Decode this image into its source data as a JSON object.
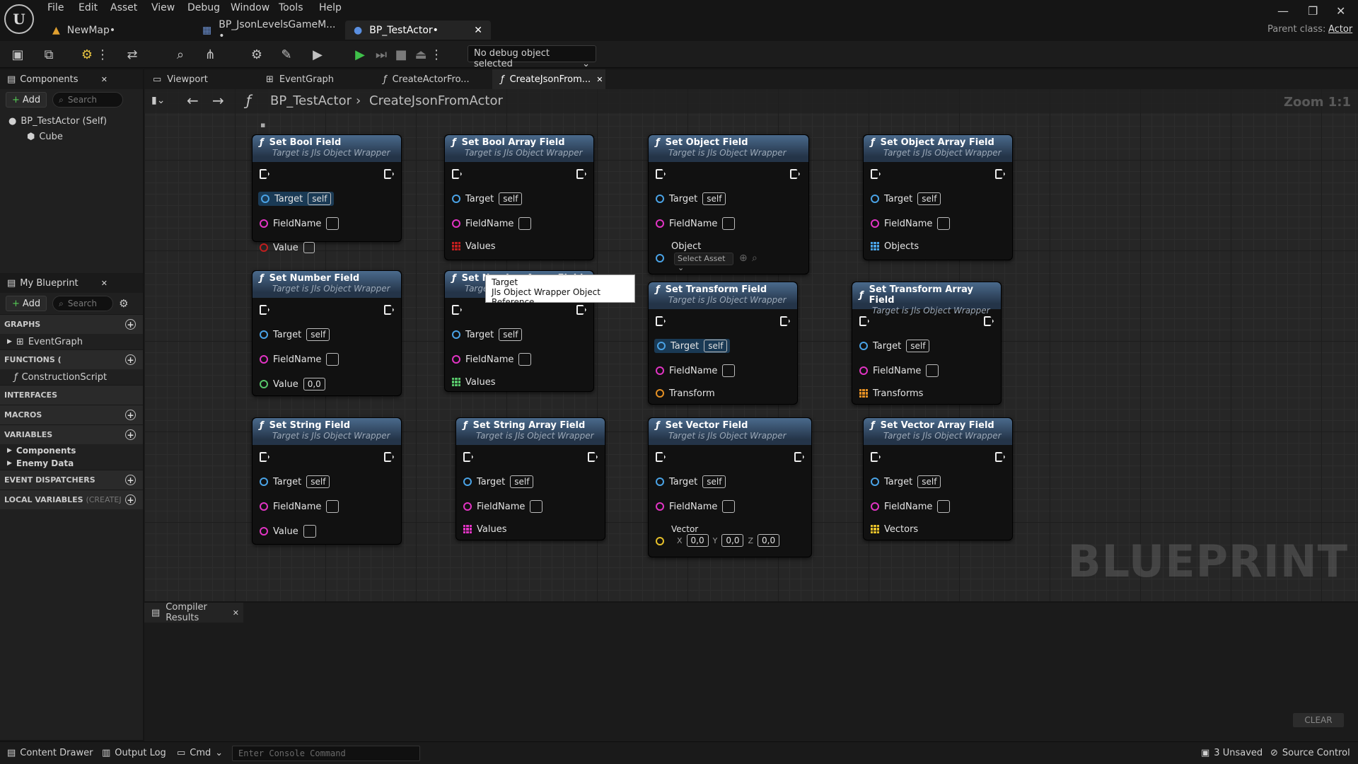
{
  "menu": [
    "File",
    "Edit",
    "Asset",
    "View",
    "Debug",
    "Window",
    "Tools",
    "Help"
  ],
  "doc_tabs": [
    {
      "label": "NewMap•"
    },
    {
      "label": "BP_JsonLevelsGameM... •"
    },
    {
      "label": "BP_TestActor•"
    }
  ],
  "parent_class": {
    "label": "Parent class:",
    "value": "Actor"
  },
  "toolbar": {
    "debug_select": "No debug object selected"
  },
  "components_panel": {
    "title": "Components",
    "add": "Add",
    "search_placeholder": "Search",
    "items": [
      {
        "label": "BP_TestActor (Self)"
      },
      {
        "label": "Cube"
      }
    ]
  },
  "my_blueprint": {
    "title": "My Blueprint",
    "add": "Add",
    "search_placeholder": "Search",
    "graphs": "GRAPHS",
    "graph_items": [
      "EventGraph"
    ],
    "functions": "FUNCTIONS (",
    "function_items": [
      "ConstructionScript"
    ],
    "interfaces": "INTERFACES",
    "macros": "MACROS",
    "variables": "VARIABLES",
    "variable_items": [
      "Components",
      "Enemy Data"
    ],
    "dispatchers": "EVENT DISPATCHERS",
    "locals": "LOCAL VARIABLES",
    "locals_hint": "(CREATEJS"
  },
  "graph_tabs": [
    "Viewport",
    "EventGraph",
    "CreateActorFro...",
    "CreateJsonFrom..."
  ],
  "breadcrumb": {
    "root": "BP_TestActor",
    "current": "CreateJsonFromActor",
    "zoom": "Zoom 1:1"
  },
  "watermark": "BLUEPRINT",
  "node_subtitle": "Target is Jls Object Wrapper",
  "pin_labels": {
    "target": "Target",
    "self": "self",
    "fieldname": "FieldName"
  },
  "nodes": {
    "bool": {
      "title": "Set Bool Field",
      "value": "Value"
    },
    "boolarr": {
      "title": "Set Bool Array Field",
      "value": "Values"
    },
    "object": {
      "title": "Set Object Field",
      "value": "Object",
      "asset": "Select Asset"
    },
    "objectarr": {
      "title": "Set Object Array Field",
      "value": "Objects"
    },
    "number": {
      "title": "Set Number Field",
      "value": "Value",
      "default": "0,0"
    },
    "numberarr": {
      "title": "Set Number Array Field",
      "value": "Values"
    },
    "transform": {
      "title": "Set Transform Field",
      "value": "Transform"
    },
    "transformarr": {
      "title": "Set Transform Array Field",
      "value": "Transforms"
    },
    "string": {
      "title": "Set String Field",
      "value": "Value"
    },
    "stringarr": {
      "title": "Set String Array Field",
      "value": "Values"
    },
    "vector": {
      "title": "Set Vector Field",
      "value": "Vector",
      "x": "0,0",
      "y": "0,0",
      "z": "0,0"
    },
    "vectorarr": {
      "title": "Set Vector Array Field",
      "value": "Vectors"
    }
  },
  "tooltip": {
    "line1": "Target",
    "line2": "Jls Object Wrapper Object Reference"
  },
  "compiler": {
    "title": "Compiler Results",
    "clear": "CLEAR"
  },
  "statusbar": {
    "content_drawer": "Content Drawer",
    "output_log": "Output Log",
    "cmd": "Cmd",
    "console_placeholder": "Enter Console Command",
    "unsaved": "3 Unsaved",
    "source_control": "Source Control"
  }
}
